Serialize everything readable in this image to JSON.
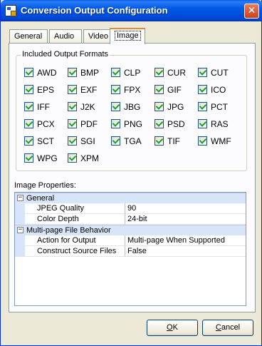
{
  "window": {
    "title": "Conversion Output Configuration",
    "close_glyph": "✕"
  },
  "tabs": [
    {
      "label": "General"
    },
    {
      "label": "Audio"
    },
    {
      "label": "Video"
    },
    {
      "label": "Image",
      "active": true
    }
  ],
  "formats": {
    "group_label": "Included Output Formats",
    "items": [
      {
        "label": "AWD",
        "checked": true
      },
      {
        "label": "BMP",
        "checked": true
      },
      {
        "label": "CLP",
        "checked": true
      },
      {
        "label": "CUR",
        "checked": true
      },
      {
        "label": "CUT",
        "checked": true
      },
      {
        "label": "EPS",
        "checked": true
      },
      {
        "label": "EXF",
        "checked": true
      },
      {
        "label": "FPX",
        "checked": true
      },
      {
        "label": "GIF",
        "checked": true
      },
      {
        "label": "ICO",
        "checked": true
      },
      {
        "label": "IFF",
        "checked": true
      },
      {
        "label": "J2K",
        "checked": true
      },
      {
        "label": "JBG",
        "checked": true
      },
      {
        "label": "JPG",
        "checked": true
      },
      {
        "label": "PCT",
        "checked": true
      },
      {
        "label": "PCX",
        "checked": true
      },
      {
        "label": "PDF",
        "checked": true
      },
      {
        "label": "PNG",
        "checked": true
      },
      {
        "label": "PSD",
        "checked": true
      },
      {
        "label": "RAS",
        "checked": true
      },
      {
        "label": "SCT",
        "checked": true
      },
      {
        "label": "SGI",
        "checked": true
      },
      {
        "label": "TGA",
        "checked": true
      },
      {
        "label": "TIF",
        "checked": true
      },
      {
        "label": "WMF",
        "checked": true
      },
      {
        "label": "WPG",
        "checked": true
      },
      {
        "label": "XPM",
        "checked": true
      }
    ]
  },
  "properties": {
    "label": "Image Properties:",
    "categories": [
      {
        "name": "General",
        "expander": "−",
        "rows": [
          {
            "name": "JPEG Quality",
            "value": "90"
          },
          {
            "name": "Color Depth",
            "value": "24-bit"
          }
        ]
      },
      {
        "name": "Multi-page File Behavior",
        "expander": "−",
        "rows": [
          {
            "name": "Action for Output",
            "value": "Multi-page When Supported"
          },
          {
            "name": "Construct Source Files",
            "value": "False"
          }
        ]
      }
    ]
  },
  "buttons": {
    "ok": {
      "mnemonic": "O",
      "rest": "K"
    },
    "cancel": {
      "mnemonic": "C",
      "rest": "ancel"
    }
  },
  "colors": {
    "titlebar": "#0054e3",
    "accent_tab": "#e68b2c",
    "check": "#21a121"
  }
}
